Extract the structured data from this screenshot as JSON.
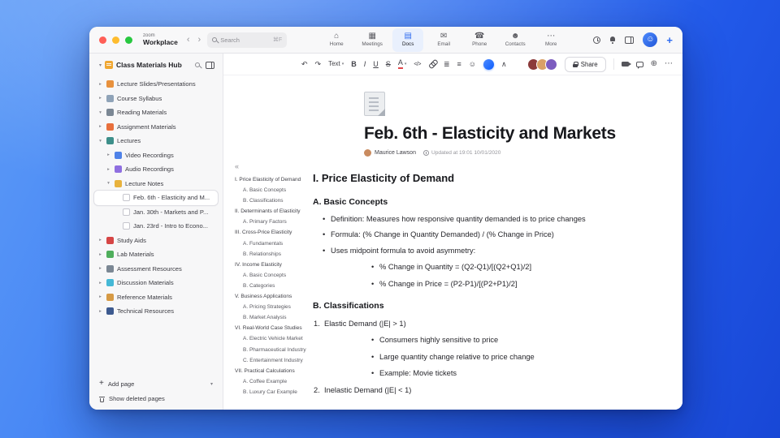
{
  "colors": {
    "accent": "#0b5cff",
    "tab_active_bg": "#e9f0fd",
    "selection_border": "#dfdfe4"
  },
  "titlebar": {
    "logo_top": "zoom",
    "logo_bottom": "Workplace",
    "nav_back": "‹",
    "nav_forward": "›",
    "search": {
      "placeholder": "Search",
      "shortcut": "⌘F"
    },
    "tabs": [
      {
        "name": "tab-home",
        "iconname": "home-icon",
        "icon": "⌂",
        "label": "Home",
        "cls": ""
      },
      {
        "name": "tab-meetings",
        "iconname": "calendar-icon",
        "icon": "▦",
        "label": "Meetings",
        "cls": ""
      },
      {
        "name": "tab-docs",
        "iconname": "docs-icon",
        "icon": "▤",
        "label": "Docs",
        "cls": "active"
      },
      {
        "name": "tab-email",
        "iconname": "mail-icon",
        "icon": "✉",
        "label": "Email",
        "cls": ""
      },
      {
        "name": "tab-phone",
        "iconname": "phone-icon",
        "icon": "☎",
        "label": "Phone",
        "cls": ""
      },
      {
        "name": "tab-contacts",
        "iconname": "contacts-icon",
        "icon": "☻",
        "label": "Contacts",
        "cls": ""
      },
      {
        "name": "tab-more",
        "iconname": "more-icon",
        "icon": "⋯",
        "label": "More",
        "cls": ""
      }
    ],
    "avatar_glyph": "☺",
    "plus": "+"
  },
  "sidebar": {
    "title": "Class Materials Hub",
    "header_chevron": "▾",
    "items": [
      {
        "label": "Lecture Slides/Presentations",
        "chev": "▸",
        "color": "#e8913d",
        "icon": "presentation-icon",
        "cls": "d0"
      },
      {
        "label": "Course Syllabus",
        "chev": "▸",
        "color": "#8fa3b8",
        "icon": "syllabus-icon",
        "cls": "d0"
      },
      {
        "label": "Reading Materials",
        "chev": "▾",
        "color": "#7b8794",
        "icon": "book-icon",
        "cls": "d0"
      },
      {
        "label": "Assignment Materials",
        "chev": "▸",
        "color": "#e8703d",
        "icon": "assignment-icon",
        "cls": "d0"
      },
      {
        "label": "Lectures",
        "chev": "▾",
        "color": "#3d8f8a",
        "icon": "lectures-icon",
        "cls": "d0"
      },
      {
        "label": "Video Recordings",
        "chev": "▸",
        "color": "#4f82e8",
        "icon": "video-icon",
        "cls": "d1"
      },
      {
        "label": "Audio Recordings",
        "chev": "▸",
        "color": "#8f6fe0",
        "icon": "audio-icon",
        "cls": "d1"
      },
      {
        "label": "Lecture Notes",
        "chev": "▾",
        "color": "#e8b23d",
        "icon": "notes-icon",
        "cls": "d1"
      },
      {
        "label": "Feb. 6th - Elasticity and M...",
        "chev": "",
        "iconcls": "pg",
        "icon": "page-icon",
        "cls": "d2 sel"
      },
      {
        "label": "Jan. 30th - Markets and P...",
        "chev": "",
        "iconcls": "pg",
        "icon": "page-icon",
        "cls": "d2"
      },
      {
        "label": "Jan. 23rd - Intro to Econo...",
        "chev": "",
        "iconcls": "pg",
        "icon": "page-icon",
        "cls": "d2"
      },
      {
        "label": "Study Aids",
        "chev": "▸",
        "color": "#d64545",
        "icon": "study-aids-icon",
        "cls": "d0"
      },
      {
        "label": "Lab Materials",
        "chev": "▸",
        "color": "#4fae5c",
        "icon": "lab-icon",
        "cls": "d0"
      },
      {
        "label": "Assessment Resources",
        "chev": "▸",
        "color": "#7b8794",
        "icon": "assessment-icon",
        "cls": "d0"
      },
      {
        "label": "Discussion Materials",
        "chev": "▸",
        "color": "#45b8d6",
        "icon": "discussion-icon",
        "cls": "d0"
      },
      {
        "label": "Reference Materials",
        "chev": "▸",
        "color": "#d69a45",
        "icon": "reference-icon",
        "cls": "d0"
      },
      {
        "label": "Technical Resources",
        "chev": "▸",
        "color": "#3d5a8f",
        "icon": "technical-icon",
        "cls": "d0"
      }
    ],
    "footer": {
      "plus_icon": "+",
      "add_page_label": "Add page",
      "chevron": "▾",
      "show_deleted_label": "Show deleted pages"
    }
  },
  "toolbar": {
    "undo_icon": "↶",
    "redo_icon": "↷",
    "text_style_label": "Text",
    "chevron": "▾",
    "bold_label": "B",
    "italic_label": "I",
    "underline_label": "U",
    "strikethrough_label": "S",
    "text_color_label": "A",
    "code_label": "</>",
    "list_icon": "≣",
    "align_icon": "≡",
    "emoji_icon": "☺",
    "collapse_icon": "∧",
    "share_label": "Share",
    "globe_icon": "⊕",
    "more_icon": "⋯"
  },
  "doc": {
    "title": "Feb. 6th - Elasticity and Markets",
    "author": "Maurice Lawson",
    "updated": "Updated at 19:01 10/01/2020",
    "outline_collapse": "«",
    "outline": [
      {
        "text": "I. Price Elasticity of Demand",
        "cls": "o0"
      },
      {
        "text": "A. Basic Concepts",
        "cls": "o1"
      },
      {
        "text": "B. Classifications",
        "cls": "o1"
      },
      {
        "text": "II. Determinants of Elasticity",
        "cls": "o0"
      },
      {
        "text": "A. Primary Factors",
        "cls": "o1"
      },
      {
        "text": "III. Cross-Price Elasticity",
        "cls": "o0"
      },
      {
        "text": "A. Fundamentals",
        "cls": "o1"
      },
      {
        "text": "B. Relationships",
        "cls": "o1"
      },
      {
        "text": "IV. Income Elasticity",
        "cls": "o0"
      },
      {
        "text": "A. Basic Concepts",
        "cls": "o1"
      },
      {
        "text": "B. Categories",
        "cls": "o1"
      },
      {
        "text": "V. Business Applications",
        "cls": "o0"
      },
      {
        "text": "A. Pricing Strategies",
        "cls": "o1"
      },
      {
        "text": "B. Market Analysis",
        "cls": "o1"
      },
      {
        "text": "VI. Real-World Case Studies",
        "cls": "o0"
      },
      {
        "text": "A. Electric Vehicle Market",
        "cls": "o1"
      },
      {
        "text": "B. Pharmaceutical Industry",
        "cls": "o1"
      },
      {
        "text": "C. Entertainment Industry",
        "cls": "o1"
      },
      {
        "text": "VII. Practical Calculations",
        "cls": "o0"
      },
      {
        "text": "A. Coffee Example",
        "cls": "o1"
      },
      {
        "text": "B. Luxury Car Example",
        "cls": "o1"
      }
    ],
    "blocks": [
      {
        "cls": "h2",
        "marker": "",
        "text": "I. Price Elasticity of Demand"
      },
      {
        "cls": "h3",
        "marker": "",
        "text": "A. Basic Concepts"
      },
      {
        "cls": "li1",
        "marker": "•",
        "text": "Definition: Measures how responsive quantity demanded is to price changes"
      },
      {
        "cls": "li1",
        "marker": "•",
        "text": "Formula: (% Change in Quantity Demanded) / (% Change in Price)"
      },
      {
        "cls": "li1",
        "marker": "•",
        "text": "Uses midpoint formula to avoid asymmetry:"
      },
      {
        "cls": "li2",
        "marker": "•",
        "text": "% Change in Quantity = (Q2-Q1)/[(Q2+Q1)/2]"
      },
      {
        "cls": "li2",
        "marker": "•",
        "text": "% Change in Price = (P2-P1)/[(P2+P1)/2]"
      },
      {
        "cls": "h3",
        "marker": "",
        "text": "B. Classifications"
      },
      {
        "cls": "num",
        "marker": "1.",
        "text": "Elastic Demand (|E| > 1)"
      },
      {
        "cls": "li2",
        "marker": "•",
        "text": "Consumers highly sensitive to price"
      },
      {
        "cls": "li2",
        "marker": "•",
        "text": "Large quantity change relative to price change"
      },
      {
        "cls": "li2",
        "marker": "•",
        "text": "Example: Movie tickets"
      },
      {
        "cls": "num",
        "marker": "2.",
        "text": "Inelastic Demand (|E| < 1)"
      }
    ]
  }
}
